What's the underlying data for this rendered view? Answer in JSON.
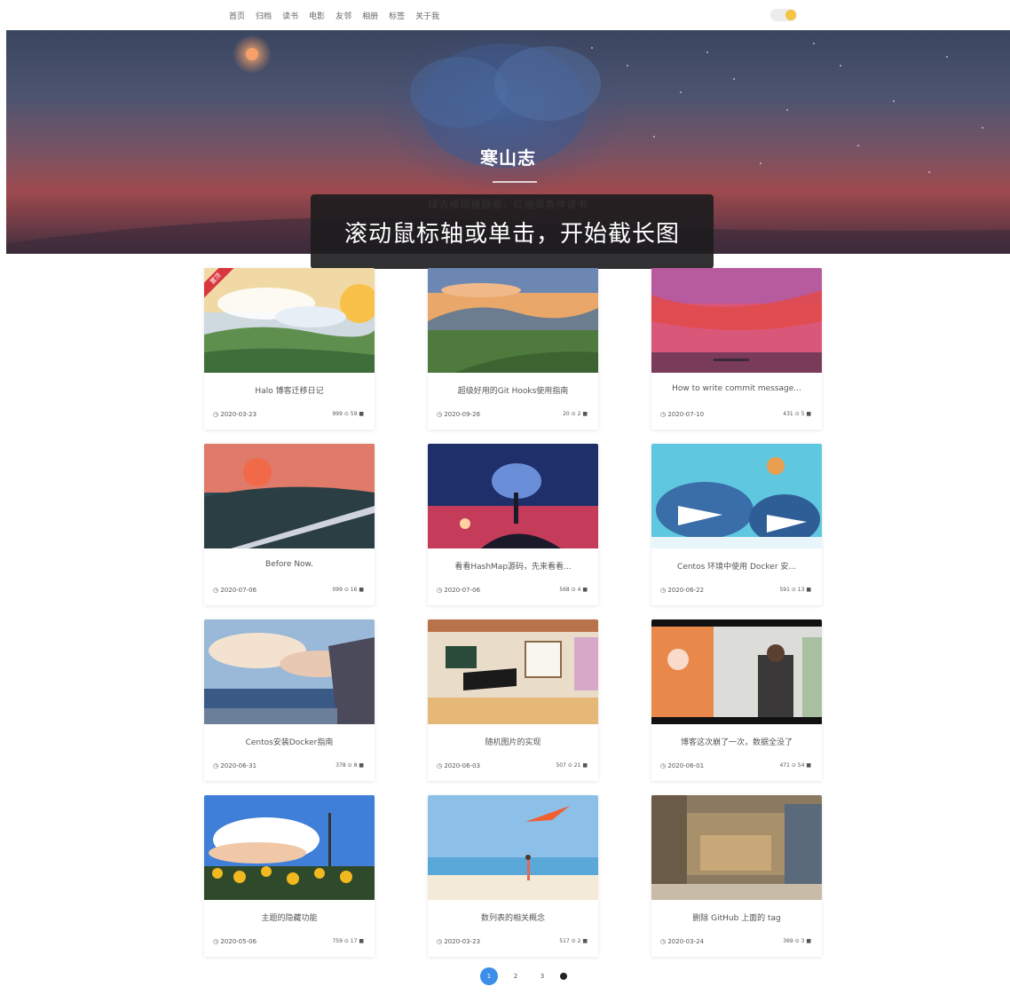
{
  "nav": {
    "items": [
      "首页",
      "归档",
      "读书",
      "电影",
      "友邻",
      "相册",
      "标签",
      "关于我"
    ]
  },
  "hero": {
    "title": "寒山志",
    "subtitle": "绿衣捧砚催题卷，红袖添香伴读书"
  },
  "overlay": {
    "tip": "滚动鼠标轴或单击，开始截长图"
  },
  "colors": {
    "accent": "#3d8ee8",
    "badge": "#d9363e",
    "toggle_knob": "#f4c542"
  },
  "posts": [
    {
      "title": "Halo 博客迁移日记",
      "date": "2020-03-23",
      "stats": "999 ⊙ 59",
      "badge": "置顶"
    },
    {
      "title": "超级好用的Git Hooks使用指南",
      "date": "2020-09-26",
      "stats": "20 ⊙ 2"
    },
    {
      "title": "How to write commit message...",
      "date": "2020-07-10",
      "stats": "431 ⊙ 5"
    },
    {
      "title": "Before Now.",
      "date": "2020-07-06",
      "stats": "099 ⊙ 16"
    },
    {
      "title": "看看HashMap源码，先来看看...",
      "date": "2020-07-06",
      "stats": "568 ⊙ 4"
    },
    {
      "title": "Centos 环境中使用 Docker 安...",
      "date": "2020-06-22",
      "stats": "591 ⊙ 13"
    },
    {
      "title": "Centos安装Docker指南",
      "date": "2020-06-31",
      "stats": "378 ⊙ 8"
    },
    {
      "title": "随机图片的实现",
      "date": "2020-06-03",
      "stats": "507 ⊙ 21"
    },
    {
      "title": "博客这次崩了一次，数据全没了",
      "date": "2020-06-01",
      "stats": "471 ⊙ 54"
    },
    {
      "title": "主题的隐藏功能",
      "date": "2020-05-06",
      "stats": "759 ⊙ 17"
    },
    {
      "title": "数列表的相关概念",
      "date": "2020-03-23",
      "stats": "517 ⊙ 2"
    },
    {
      "title": "删除 GitHub 上面的 tag",
      "date": "2020-03-24",
      "stats": "369 ⊙ 3"
    }
  ],
  "pagination": {
    "pages": [
      "1",
      "2",
      "3"
    ],
    "current": "1"
  }
}
